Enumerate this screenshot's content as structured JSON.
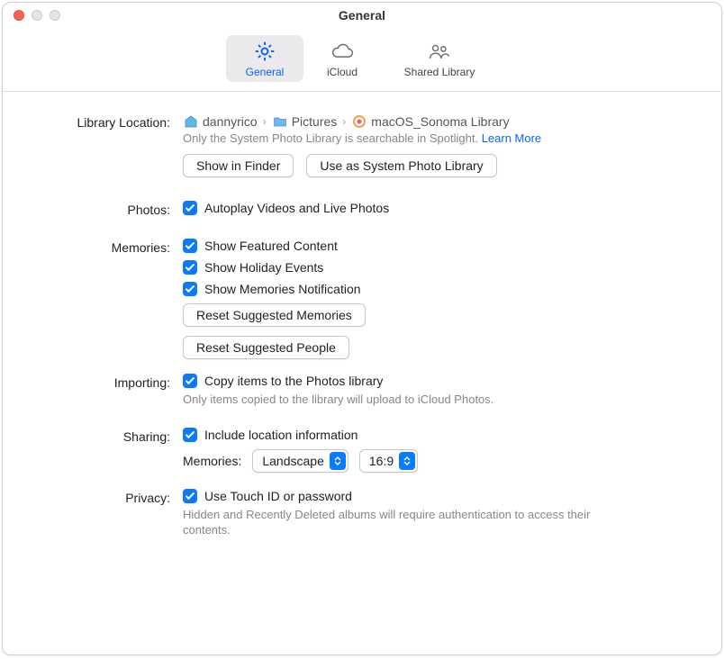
{
  "window": {
    "title": "General"
  },
  "toolbar": {
    "general": "General",
    "icloud": "iCloud",
    "shared": "Shared Library"
  },
  "libraryLocation": {
    "label": "Library Location:",
    "path": [
      "dannyrico",
      "Pictures",
      "macOS_Sonoma Library"
    ],
    "note": "Only the System Photo Library is searchable in Spotlight.",
    "learnMore": "Learn More",
    "showInFinder": "Show in Finder",
    "useAsSystem": "Use as System Photo Library"
  },
  "photos": {
    "label": "Photos:",
    "autoplay": "Autoplay Videos and Live Photos"
  },
  "memories": {
    "label": "Memories:",
    "featured": "Show Featured Content",
    "holiday": "Show Holiday Events",
    "notification": "Show Memories Notification",
    "resetMemories": "Reset Suggested Memories",
    "resetPeople": "Reset Suggested People"
  },
  "importing": {
    "label": "Importing:",
    "copy": "Copy items to the Photos library",
    "note": "Only items copied to the library will upload to iCloud Photos."
  },
  "sharing": {
    "label": "Sharing:",
    "location": "Include location information",
    "memoriesLabel": "Memories:",
    "orientation": "Landscape",
    "aspect": "16:9"
  },
  "privacy": {
    "label": "Privacy:",
    "touchid": "Use Touch ID or password",
    "note": "Hidden and Recently Deleted albums will require authentication to access their contents."
  }
}
